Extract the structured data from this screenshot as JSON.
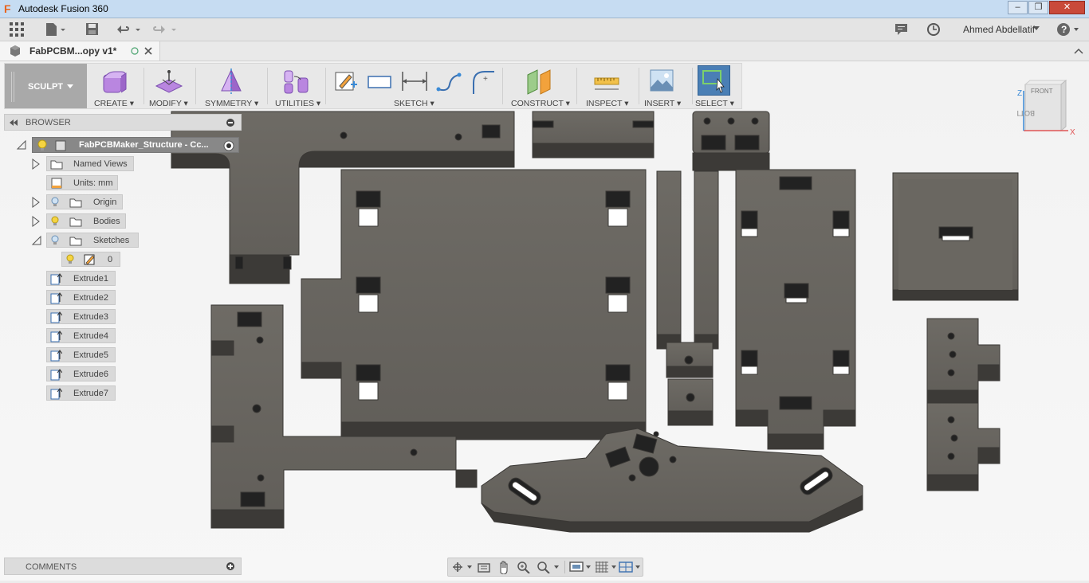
{
  "app": {
    "title": "Autodesk Fusion 360",
    "logo_letter": "F"
  },
  "window": {
    "minimize": "–",
    "maximize": "❐",
    "close": "✕"
  },
  "appbar": {
    "user": "Ahmed Abdellatif"
  },
  "doc_tab": {
    "label": "FabPCBM...opy v1*"
  },
  "toolbar": {
    "workspace": "SCULPT",
    "groups": [
      "CREATE",
      "MODIFY",
      "SYMMETRY",
      "UTILITIES",
      "SKETCH",
      "CONSTRUCT",
      "INSPECT",
      "INSERT",
      "SELECT"
    ]
  },
  "browser": {
    "title": "BROWSER",
    "root": "FabPCBMaker_Structure - Cc...",
    "nodes": [
      "Named Views",
      "Units: mm",
      "Origin",
      "Bodies",
      "Sketches",
      "0",
      "Extrude1",
      "Extrude2",
      "Extrude3",
      "Extrude4",
      "Extrude5",
      "Extrude6",
      "Extrude7"
    ]
  },
  "comments": {
    "title": "COMMENTS"
  },
  "viewcube": {
    "front": "FRONT",
    "bottom": "BOTTOM",
    "z": "Z",
    "x": "X"
  },
  "colors": {
    "part": "#6b6862",
    "part_edge": "#3e3c38",
    "accent": "#4a7fb5"
  }
}
